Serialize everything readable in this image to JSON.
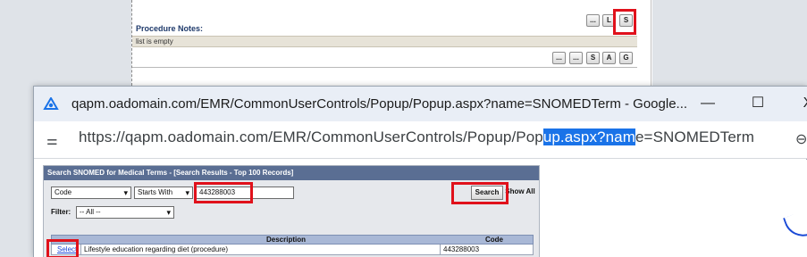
{
  "background_page": {
    "procedure_notes_label": "Procedure Notes:",
    "list_empty_text": "list is empty",
    "top_buttons": [
      "...",
      "L",
      "S"
    ],
    "bottom_buttons": [
      "...",
      "...",
      "S",
      "A",
      "G"
    ]
  },
  "popup_window": {
    "title": "qapm.oadomain.com/EMR/CommonUserControls/Popup/Popup.aspx?name=SNOMEDTerm - Google...",
    "controls": {
      "minimize": "—",
      "maximize": "☐",
      "close": "X"
    },
    "address": {
      "url_prefix": "https://qapm.oadomain.com/EMR/CommonUserControls/Popup/Pop",
      "url_selected": "up.aspx?nam",
      "url_suffix": "e=SNOMEDTerm",
      "site_info_icon": "tune-icon",
      "right_glyph": "⊖"
    }
  },
  "search_panel": {
    "header": "Search SNOMED for Medical Terms - [Search Results - Top 100 Records]",
    "field_select": "Code",
    "match_select": "Starts With",
    "search_value": "443288003",
    "search_button": "Search",
    "show_all_button": "Show All",
    "filter_label": "Filter:",
    "filter_select": "-- All --",
    "table": {
      "columns": [
        "",
        "Description",
        "Code"
      ],
      "rows": [
        {
          "action": "Select",
          "description": "Lifestyle education regarding diet (procedure)",
          "code": "443288003"
        }
      ]
    }
  },
  "colors": {
    "highlight_red": "#e0111b",
    "panel_header": "#5a6e93",
    "table_header": "#a9b8d6",
    "selection_blue": "#1a73e8"
  }
}
